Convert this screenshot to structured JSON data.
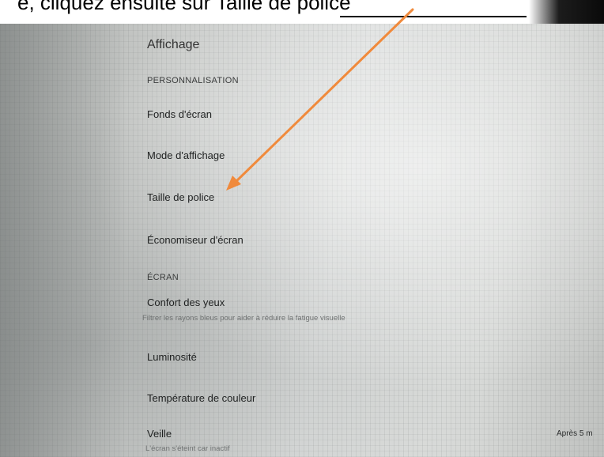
{
  "caption": {
    "text": "e, cliquez ensuite sur Taille de police"
  },
  "page": {
    "title": "Affichage"
  },
  "sections": {
    "personnalisation": "PERSONNALISATION",
    "ecran": "ÉCRAN"
  },
  "items": {
    "fonds_ecran": {
      "label": "Fonds d'écran"
    },
    "mode_affichage": {
      "label": "Mode d'affichage"
    },
    "taille_police": {
      "label": "Taille de police"
    },
    "economiseur": {
      "label": "Économiseur d'écran"
    },
    "confort_yeux": {
      "label": "Confort des yeux",
      "sub": "Filtrer les rayons bleus pour aider à réduire la fatigue visuelle"
    },
    "luminosite": {
      "label": "Luminosité"
    },
    "temperature": {
      "label": "Température de couleur"
    },
    "veille": {
      "label": "Veille",
      "sub": "L'écran s'éteint car inactif",
      "value": "Après 5 m"
    }
  },
  "annotation": {
    "arrow_color": "#f08a3c"
  }
}
